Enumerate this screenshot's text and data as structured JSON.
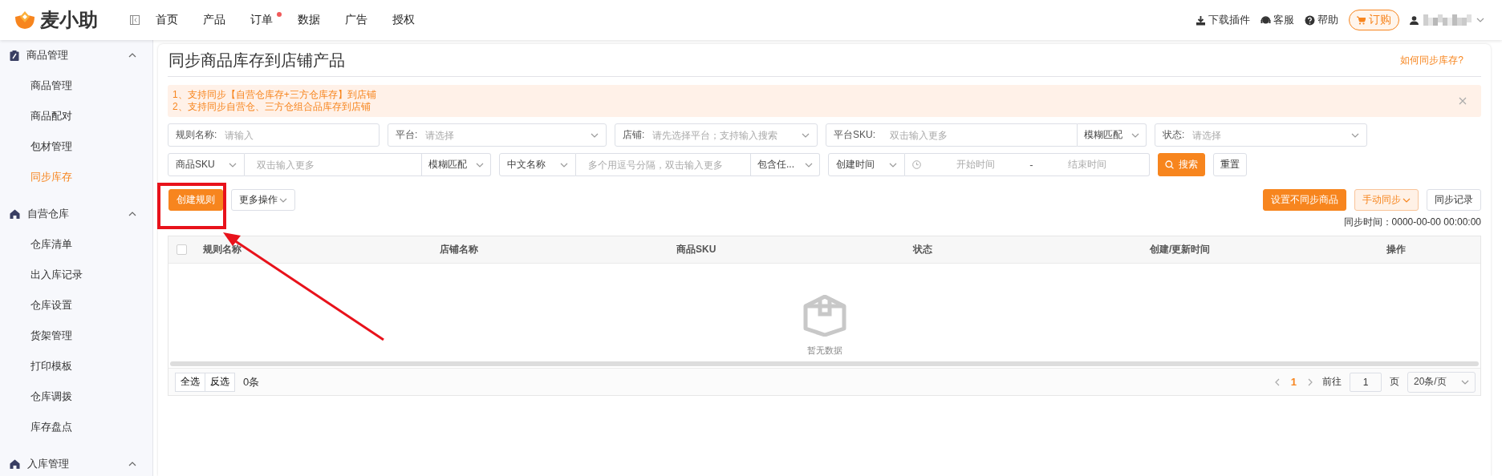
{
  "header": {
    "logo": "麦小助",
    "nav": [
      {
        "label": "首页",
        "badge": false
      },
      {
        "label": "产品",
        "badge": false
      },
      {
        "label": "订单",
        "badge": true
      },
      {
        "label": "数据",
        "badge": false
      },
      {
        "label": "广告",
        "badge": false
      },
      {
        "label": "授权",
        "badge": false
      }
    ],
    "actions": [
      {
        "kind": "download",
        "label": "下载插件"
      },
      {
        "kind": "service",
        "label": "客服"
      },
      {
        "kind": "help",
        "label": "帮助"
      }
    ],
    "order_button": "订购"
  },
  "sidebar": {
    "groups": [
      {
        "label": "商品管理",
        "kind": "clipboard",
        "expanded": true,
        "children": [
          {
            "label": "商品管理",
            "selected": false
          },
          {
            "label": "商品配对",
            "selected": false
          },
          {
            "label": "包材管理",
            "selected": false
          },
          {
            "label": "同步库存",
            "selected": true
          }
        ]
      },
      {
        "label": "自营仓库",
        "kind": "house",
        "expanded": true,
        "children": [
          {
            "label": "仓库清单",
            "selected": false
          },
          {
            "label": "出入库记录",
            "selected": false
          },
          {
            "label": "仓库设置",
            "selected": false
          },
          {
            "label": "货架管理",
            "selected": false
          },
          {
            "label": "打印模板",
            "selected": false
          },
          {
            "label": "仓库调拨",
            "selected": false
          },
          {
            "label": "库存盘点",
            "selected": false
          }
        ]
      },
      {
        "label": "入库管理",
        "kind": "house",
        "expanded": true
      }
    ]
  },
  "page": {
    "title": "同步商品库存到店铺产品",
    "help_link": "如何同步库存?"
  },
  "notice": {
    "lines": [
      "1、支持同步【自营仓库存+三方仓库存】到店铺",
      "2、支持同步自营仓、三方仓组合品库存到店铺"
    ]
  },
  "filters": {
    "row_1": [
      {
        "kind": "input",
        "label": "规则名称:",
        "placeholder": "请输入"
      },
      {
        "kind": "select",
        "label": "平台:",
        "placeholder": "请选择"
      },
      {
        "kind": "select",
        "label": "店铺:",
        "placeholder": "请先选择平台；支持输入搜索"
      },
      {
        "kind": "match_input",
        "label": "平台SKU:",
        "placeholder": "双击输入更多",
        "match": "模糊匹配"
      },
      {
        "kind": "select",
        "label": "状态:",
        "placeholder": "请选择"
      }
    ],
    "row_2": [
      {
        "kind": "select_input",
        "selector": "商品SKU",
        "placeholder": "双击输入更多",
        "match": "模糊匹配"
      },
      {
        "kind": "select_input",
        "selector": "中文名称",
        "placeholder": "多个用逗号分隔，双击输入更多",
        "match": "包含任..."
      },
      {
        "kind": "date_range",
        "selector": "创建时间",
        "start": "开始时间",
        "separator": "-",
        "end": "结束时间"
      }
    ],
    "search_button": "搜索",
    "reset_button": "重置"
  },
  "toolbar": {
    "left": [
      {
        "kind": "primary",
        "label": "创建规则",
        "dropdown": false
      },
      {
        "kind": "default",
        "label": "更多操作",
        "dropdown": true
      }
    ],
    "right": [
      {
        "kind": "primary",
        "label": "设置不同步商品",
        "dropdown": false
      },
      {
        "kind": "light",
        "label": "手动同步",
        "dropdown": true
      },
      {
        "kind": "default",
        "label": "同步记录",
        "dropdown": false
      }
    ],
    "sync_time": "同步时间：0000-00-00 00:00:00"
  },
  "table": {
    "select_all_checked": false,
    "columns": [
      "规则名称",
      "店铺名称",
      "商品SKU",
      "状态",
      "创建/更新时间",
      "操作"
    ],
    "empty_text": "暂无数据"
  },
  "footer": {
    "select_all": "全选",
    "invert": "反选",
    "count": "0条",
    "pages": [
      {
        "label": "1",
        "selected": true
      }
    ],
    "goto": "前往",
    "page_input": "1",
    "page_unit": "页",
    "page_size": "20条/页"
  }
}
